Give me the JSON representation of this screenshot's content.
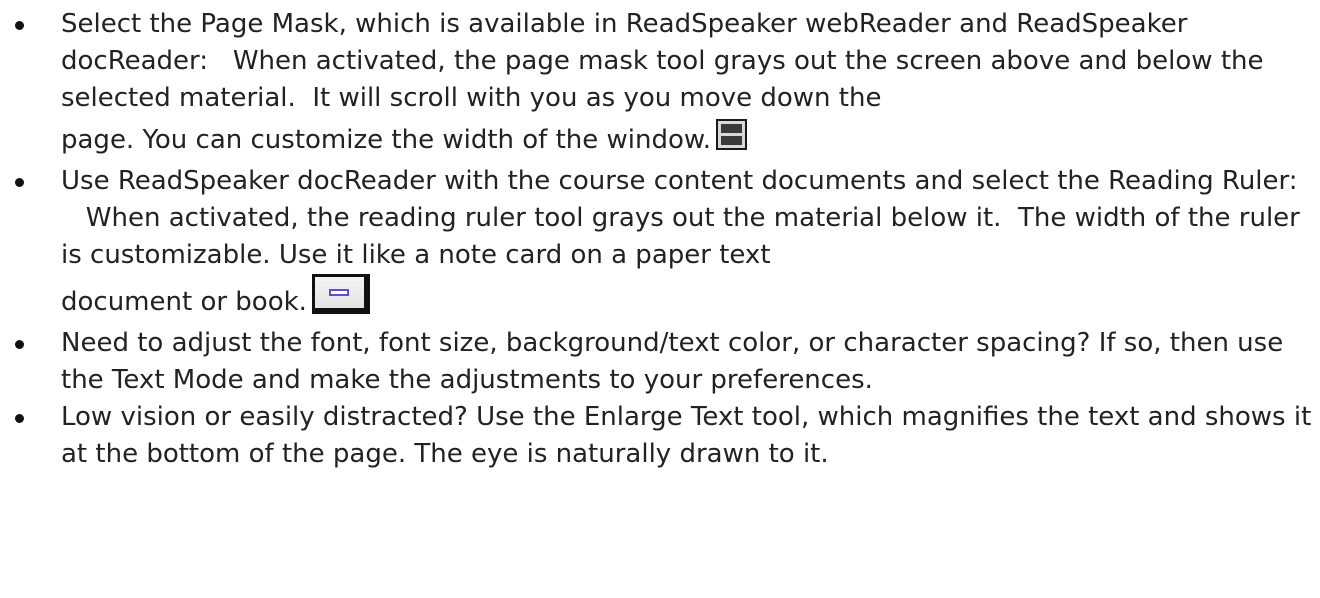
{
  "items": [
    {
      "text_part1": "Select the Page Mask, which is available in ReadSpeaker webReader and ReadSpeaker docReader:",
      "text_part2": "When activated, the page mask tool grays out the screen above and below the selected material.",
      "text_part3": "It will scroll with you as you move down the",
      "last_line": "page. You can customize the width of the window.",
      "icon": "page-mask-icon"
    },
    {
      "text_part1": "Use ReadSpeaker docReader with the course content documents and select the Reading Ruler:",
      "text_part2": "When activated, the reading ruler tool grays out the material below it.",
      "text_part3": "The width of the ruler is customizable. Use it like a note card on a paper text",
      "last_line": "document or book.",
      "icon": "reading-ruler-icon"
    },
    {
      "text": "Need to adjust the font, font size, background/text color, or character spacing? If so, then use the Text Mode and make the adjustments to your preferences."
    },
    {
      "text": "Low vision or easily distracted? Use the Enlarge Text tool, which magnifies the text and shows it at the bottom of the page.  The eye is naturally drawn to it."
    }
  ]
}
